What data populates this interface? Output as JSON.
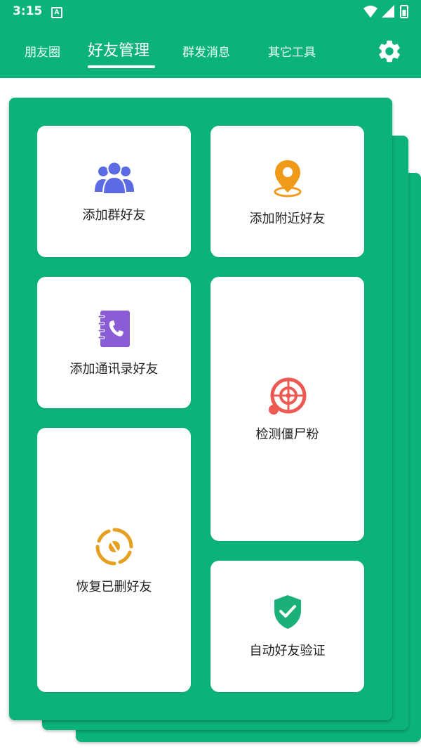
{
  "status_bar": {
    "time": "3:15",
    "notification_glyph": "A"
  },
  "tabs": [
    {
      "label": "朋友圈"
    },
    {
      "label": "好友管理"
    },
    {
      "label": "群发消息"
    },
    {
      "label": "其它工具"
    }
  ],
  "active_tab": "好友管理",
  "colors": {
    "primary": "#0bb27b",
    "people": "#5b6be3",
    "location": "#f09a1a",
    "contacts": "#8a5cd6",
    "target": "#ec5a53",
    "restore": "#e6a01f",
    "shield": "#19b07a"
  },
  "cards": {
    "add_group_friends": {
      "label": "添加群好友",
      "icon": "people-group-icon"
    },
    "add_nearby_friends": {
      "label": "添加附近好友",
      "icon": "location-pin-icon"
    },
    "add_contacts_friends": {
      "label": "添加通讯录好友",
      "icon": "contacts-book-icon"
    },
    "detect_zombie_fans": {
      "label": "检测僵尸粉",
      "icon": "target-icon"
    },
    "restore_deleted_friends": {
      "label": "恢复已删好友",
      "icon": "restore-icon"
    },
    "auto_friend_verification": {
      "label": "自动好友验证",
      "icon": "shield-check-icon"
    }
  }
}
